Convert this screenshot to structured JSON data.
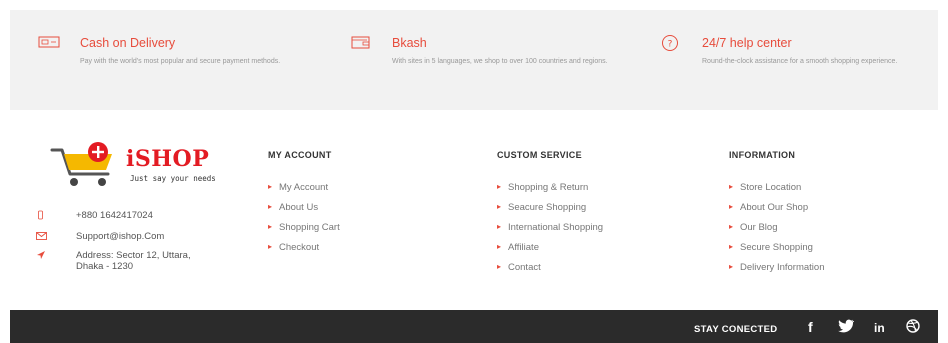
{
  "features": [
    {
      "icon": "cash-icon",
      "title": "Cash on Delivery",
      "desc": "Pay with the world's most popular and secure payment methods."
    },
    {
      "icon": "wallet-icon",
      "title": "Bkash",
      "desc": "With sites in 5 languages, we shop to over 100 countries and regions."
    },
    {
      "icon": "help-icon",
      "title": "24/7 help center",
      "desc": "Round-the-clock assistance for a smooth shopping experience."
    }
  ],
  "brand": {
    "name": "iSHOP",
    "tagline": "Just say your needs",
    "accent": "#e31b23",
    "cart_color": "#f5b800"
  },
  "contact": {
    "phone": "+880 1642417024",
    "email": "Support@ishop.Com",
    "address_line1": "Address: Sector 12, Uttara,",
    "address_line2": "Dhaka - 1230"
  },
  "columns": [
    {
      "title": "MY ACCOUNT",
      "items": [
        "My Account",
        "About Us",
        "Shopping Cart",
        "Checkout"
      ]
    },
    {
      "title": "CUSTOM SERVICE",
      "items": [
        "Shopping & Return",
        "Seacure Shopping",
        "International Shopping",
        "Affiliate",
        "Contact"
      ]
    },
    {
      "title": "INFORMATION",
      "items": [
        "Store Location",
        "About Our Shop",
        "Our Blog",
        "Secure Shopping",
        "Delivery Information"
      ]
    }
  ],
  "footer_bar": {
    "stay_label": "STAY CONECTED",
    "social": [
      {
        "name": "facebook",
        "glyph": "f"
      },
      {
        "name": "twitter",
        "glyph": ""
      },
      {
        "name": "linkedin",
        "glyph": "in"
      },
      {
        "name": "dribbble",
        "glyph": ""
      }
    ]
  },
  "colors": {
    "accent": "#e74c3c",
    "feature_bg": "#f2f2f2",
    "bar_bg": "#2b2b2b"
  }
}
